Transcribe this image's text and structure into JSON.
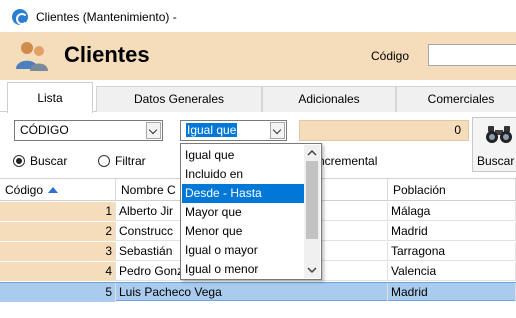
{
  "window": {
    "title": "Clientes (Mantenimiento) -",
    "icon": "app-logo-icon"
  },
  "header": {
    "title": "Clientes",
    "icon": "people-icon",
    "code_label": "Código",
    "code_value": ""
  },
  "tabs": [
    {
      "label": "Lista",
      "active": true
    },
    {
      "label": "Datos Generales",
      "active": false
    },
    {
      "label": "Adicionales",
      "active": false
    },
    {
      "label": "Comerciales",
      "active": false
    }
  ],
  "filter": {
    "field": "CÓDIGO",
    "operator": "Igual que",
    "value": "0",
    "mode_buscar": "Buscar",
    "mode_filtrar": "Filtrar",
    "mode_selected": "Buscar",
    "incremental_label": "ncremental",
    "search_button_label": "Buscar",
    "search_icon": "binoculars-icon"
  },
  "grid": {
    "columns": [
      "Código",
      "Nombre C",
      "Población"
    ],
    "sort": {
      "column": "Código",
      "direction": "asc"
    },
    "rows": [
      {
        "code": "1",
        "name": "Alberto Jir",
        "town": "Málaga",
        "selected": false
      },
      {
        "code": "2",
        "name": "Construcc",
        "town": "Madrid",
        "selected": false
      },
      {
        "code": "3",
        "name": "Sebastián",
        "town": "Tarragona",
        "selected": false
      },
      {
        "code": "4",
        "name": "Pedro Gonzalez Frías",
        "town": "Valencia",
        "selected": false
      },
      {
        "code": "5",
        "name": "Luis Pacheco Vega",
        "town": "Madrid",
        "selected": true
      }
    ]
  },
  "operator_dropdown": {
    "open": true,
    "highlighted": "Desde - Hasta",
    "options": [
      "Igual que",
      "Incluido en",
      "Desde - Hasta",
      "Mayor que",
      "Menor que",
      "Igual o mayor",
      "Igual o menor"
    ]
  },
  "colors": {
    "accent": "#f5dcba",
    "selection": "#0078d7",
    "row_selected": "#a9cbee"
  }
}
